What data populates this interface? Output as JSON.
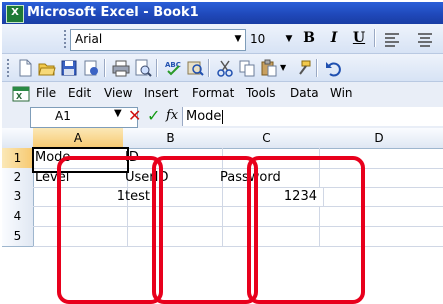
{
  "window": {
    "app_icon": "excel-icon",
    "title": "Microsoft Excel - Book1"
  },
  "font_toolbar": {
    "font_name": "Arial",
    "font_size": "10",
    "bold": "B",
    "italic": "I",
    "underline": "U"
  },
  "standard_toolbar": {
    "icons": [
      "new-icon",
      "open-icon",
      "save-icon",
      "permission-icon",
      "print-icon",
      "print-preview-icon",
      "spelling-icon",
      "research-icon",
      "cut-icon",
      "copy-icon",
      "paste-icon",
      "format-painter-icon",
      "undo-icon"
    ]
  },
  "menu": {
    "items": [
      {
        "label": "File"
      },
      {
        "label": "Edit"
      },
      {
        "label": "View"
      },
      {
        "label": "Insert"
      },
      {
        "label": "Format"
      },
      {
        "label": "Tools"
      },
      {
        "label": "Data"
      },
      {
        "label": "Win"
      }
    ]
  },
  "formula_bar": {
    "name_box": "A1",
    "fx": "fx",
    "value": "Mode"
  },
  "sheet": {
    "columns": [
      "A",
      "B",
      "C",
      "D"
    ],
    "rows": [
      {
        "num": "1",
        "cells": [
          "Mode",
          "ID",
          "",
          ""
        ]
      },
      {
        "num": "2",
        "cells": [
          "Level",
          "UserID",
          "Password",
          ""
        ]
      },
      {
        "num": "3",
        "cells": [
          "1",
          "test",
          "1234",
          ""
        ]
      },
      {
        "num": "4",
        "cells": [
          "",
          "",
          "",
          ""
        ]
      },
      {
        "num": "5",
        "cells": [
          "",
          "",
          "",
          ""
        ]
      }
    ],
    "active_cell": "A1"
  },
  "annotation": {
    "color": "#e8001c",
    "highlighted_columns": [
      "A",
      "B",
      "C"
    ]
  }
}
